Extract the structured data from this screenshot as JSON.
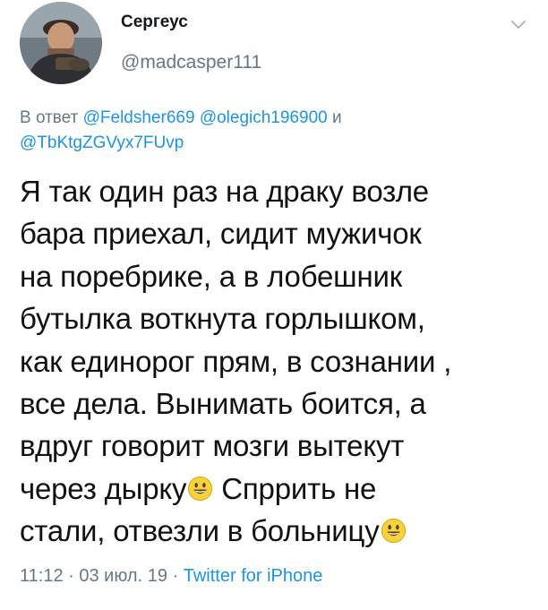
{
  "author": {
    "display_name": "Сергеус",
    "handle": "@madcasper111"
  },
  "reply": {
    "prefix": "В ответ",
    "mentions": [
      "@Feldsher669",
      "@olegich196900",
      "@TbKtgZGVyx7FUvp"
    ],
    "conjunction": "и"
  },
  "tweet": {
    "lines": [
      "Я так один раз на драку возле",
      "бара приехал, сидит мужичок",
      "на поребрике, а в лобешник",
      "бутылка воткнута горлышком,",
      "как единорог прям, в сознании ,",
      "все дела. Вынимать боится, а",
      "вдруг говорит мозги вытекут",
      "через дырку",
      "Спррить не",
      "стали, отвезли в больницу"
    ],
    "emoji_names": [
      "smiley-emoji",
      "smiley-emoji"
    ]
  },
  "meta": {
    "time": "11:12",
    "separator": "·",
    "date": "03 июл. 19",
    "source": "Twitter for iPhone"
  },
  "icons": {
    "menu": "chevron-down-icon"
  },
  "colors": {
    "link": "#1b95e0",
    "secondary": "#657786",
    "text": "#111111",
    "emoji_fill": "#f7d33b"
  }
}
